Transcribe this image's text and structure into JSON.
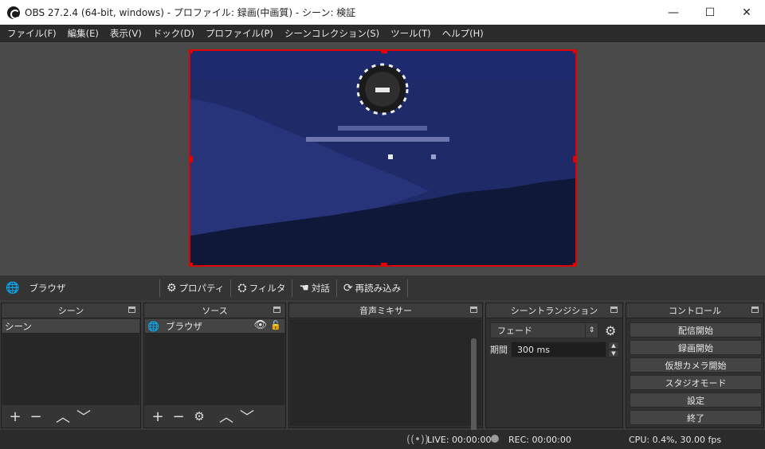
{
  "window": {
    "title": "OBS 27.2.4 (64-bit, windows) - プロファイル: 録画(中画質) - シーン: 検証",
    "minimize": "—",
    "maximize": "☐",
    "close": "✕"
  },
  "menu": [
    {
      "label": "ファイル(F)"
    },
    {
      "label": "編集(E)"
    },
    {
      "label": "表示(V)"
    },
    {
      "label": "ドック(D)"
    },
    {
      "label": "プロファイル(P)"
    },
    {
      "label": "シーンコレクション(S)"
    },
    {
      "label": "ツール(T)"
    },
    {
      "label": "ヘルプ(H)"
    }
  ],
  "source_toolbar": {
    "selected_source": "ブラウザ",
    "properties": "プロパティ",
    "filters": "フィルタ",
    "interact": "対話",
    "refresh": "再読み込み"
  },
  "scenes_dock": {
    "title": "シーン",
    "items": [
      "シーン"
    ]
  },
  "sources_dock": {
    "title": "ソース",
    "items": [
      {
        "name": "ブラウザ",
        "visible": true,
        "locked": false
      }
    ]
  },
  "mixer_dock": {
    "title": "音声ミキサー"
  },
  "transitions_dock": {
    "title": "シーントランジション",
    "transition": "フェード",
    "duration_label": "期間",
    "duration_value": "300 ms"
  },
  "controls_dock": {
    "title": "コントロール",
    "buttons": [
      "配信開始",
      "録画開始",
      "仮想カメラ開始",
      "スタジオモード",
      "設定",
      "終了"
    ]
  },
  "status": {
    "live": "LIVE: 00:00:00",
    "rec": "REC: 00:00:00",
    "cpu": "CPU: 0.4%, 30.00 fps"
  },
  "colors": {
    "selection": "#e00000",
    "preview_bg": "#0f1838"
  }
}
